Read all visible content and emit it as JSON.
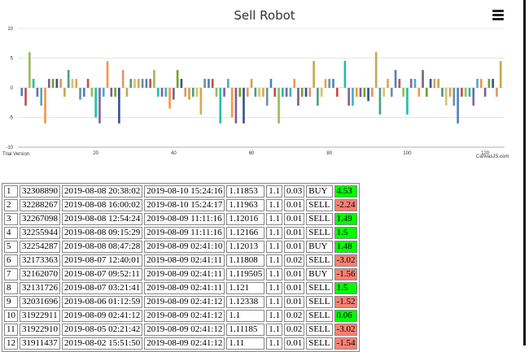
{
  "chart": {
    "menu_icon": "hamburger-icon",
    "trial_text": "Trial Version",
    "credit_text": "CanvasJS.com"
  },
  "chart_data": {
    "type": "bar",
    "title": "Sell Robot",
    "xlabel": "",
    "ylabel": "",
    "ylim": [
      -10,
      10
    ],
    "xlim": [
      0,
      125
    ],
    "yticks": [
      -10,
      -5,
      0,
      5,
      10
    ],
    "xticks": [
      20,
      40,
      60,
      80,
      100,
      120
    ],
    "grid": true,
    "colors": [
      "#4F81BC",
      "#C0504E",
      "#9BBB58",
      "#23BFAA",
      "#8064A1",
      "#4AACC5",
      "#F79647",
      "#7F6084",
      "#77A033",
      "#33558B",
      "#E59566",
      "#C2AA4C",
      "#4D9E80",
      "#D1C56C",
      "#E0A54D",
      "#6B8FAA"
    ],
    "x": [
      1,
      2,
      3,
      4,
      5,
      6,
      7,
      8,
      9,
      10,
      11,
      12,
      13,
      14,
      15,
      16,
      17,
      18,
      19,
      20,
      21,
      22,
      23,
      24,
      25,
      26,
      27,
      28,
      29,
      30,
      31,
      32,
      33,
      34,
      35,
      36,
      37,
      38,
      39,
      40,
      41,
      42,
      43,
      44,
      45,
      46,
      47,
      48,
      49,
      50,
      51,
      52,
      53,
      54,
      55,
      56,
      57,
      58,
      59,
      60,
      61,
      62,
      63,
      64,
      65,
      66,
      67,
      68,
      69,
      70,
      71,
      72,
      73,
      74,
      75,
      76,
      77,
      78,
      79,
      80,
      81,
      82,
      83,
      84,
      85,
      86,
      87,
      88,
      89,
      90,
      91,
      92,
      93,
      94,
      95,
      96,
      97,
      98,
      99,
      100,
      101,
      102,
      103,
      104,
      105,
      106,
      107,
      108,
      109,
      110,
      111,
      112,
      113,
      114,
      115,
      116,
      117,
      118,
      119,
      120,
      121,
      122,
      123,
      124
    ],
    "values": [
      -1.4,
      -3,
      6,
      1.5,
      -1.5,
      -3,
      -6,
      1.5,
      1.5,
      1.5,
      1.5,
      -1.5,
      3,
      1.5,
      1.5,
      -2,
      -1.5,
      1.5,
      -1.5,
      -5,
      -6,
      -1.5,
      4.5,
      -1.5,
      -1.5,
      -6,
      3,
      -1.5,
      1.5,
      1.5,
      1.5,
      1.5,
      1.5,
      1.5,
      3,
      -1.5,
      -1.5,
      -1.5,
      -3.5,
      -2,
      3,
      1.5,
      -1.5,
      -2,
      -1.5,
      -1.5,
      -4.5,
      1.5,
      1.5,
      1.5,
      -1.5,
      -6,
      -1.5,
      1.5,
      -5,
      -6,
      -1.5,
      -6,
      -1.5,
      1.5,
      -1.5,
      -1.5,
      -1.5,
      -3,
      1.5,
      -1.5,
      -6,
      -1.5,
      -1.5,
      -1.5,
      1.5,
      -3,
      -1.5,
      -1.5,
      -1.5,
      4.5,
      -3,
      -1.5,
      1.48,
      1.49,
      1.5,
      -1.5,
      0.06,
      4.53,
      -3.02,
      -3.02,
      -1.52,
      -1.54,
      -1.56,
      -2.24,
      -1.5,
      6,
      -4.5,
      -1.5,
      1.5,
      -1.5,
      3,
      1.5,
      -1.5,
      -4.5,
      1.5,
      1.5,
      -1.5,
      3,
      -1.5,
      1.5,
      1.5,
      1.5,
      -1.5,
      -3,
      -1.5,
      -3,
      -6,
      -1.5,
      -1.5,
      -1.5,
      -3,
      1.5,
      1.5,
      -1.5,
      1.5,
      1.5,
      -1.5,
      4.5
    ]
  },
  "table": {
    "rows": [
      {
        "n": "1",
        "ticket": "32308890",
        "open": "2019-08-08 20:38:02",
        "close": "2019-08-10 15:24:16",
        "price": "1.11853",
        "lev": "1.1",
        "lot": "0.03",
        "side": "BUY",
        "pl": "4.53",
        "pl_sign": "pos"
      },
      {
        "n": "2",
        "ticket": "32288267",
        "open": "2019-08-08 16:00:02",
        "close": "2019-08-10 15:24:17",
        "price": "1.11963",
        "lev": "1.1",
        "lot": "0.01",
        "side": "SELL",
        "pl": "-2.24",
        "pl_sign": "neg"
      },
      {
        "n": "3",
        "ticket": "32267098",
        "open": "2019-08-08 12:54:24",
        "close": "2019-08-09 11:11:16",
        "price": "1.12016",
        "lev": "1.1",
        "lot": "0.01",
        "side": "SELL",
        "pl": "1.49",
        "pl_sign": "pos"
      },
      {
        "n": "4",
        "ticket": "32255944",
        "open": "2019-08-08 09:15:29",
        "close": "2019-08-09 11:11:16",
        "price": "1.12166",
        "lev": "1.1",
        "lot": "0.01",
        "side": "SELL",
        "pl": "1.5",
        "pl_sign": "pos"
      },
      {
        "n": "5",
        "ticket": "32254287",
        "open": "2019-08-08 08:47:28",
        "close": "2019-08-09 02:41:10",
        "price": "1.12013",
        "lev": "1.1",
        "lot": "0.01",
        "side": "BUY",
        "pl": "1.48",
        "pl_sign": "pos"
      },
      {
        "n": "6",
        "ticket": "32173363",
        "open": "2019-08-07 12:40:01",
        "close": "2019-08-09 02:41:11",
        "price": "1.11808",
        "lev": "1.1",
        "lot": "0.02",
        "side": "SELL",
        "pl": "-3.02",
        "pl_sign": "neg"
      },
      {
        "n": "7",
        "ticket": "32162070",
        "open": "2019-08-07 09:52:11",
        "close": "2019-08-09 02:41:11",
        "price": "1.119505",
        "lev": "1.1",
        "lot": "0.01",
        "side": "BUY",
        "pl": "-1.56",
        "pl_sign": "neg"
      },
      {
        "n": "8",
        "ticket": "32131726",
        "open": "2019-08-07 03:21:41",
        "close": "2019-08-09 02:41:11",
        "price": "1.121",
        "lev": "1.1",
        "lot": "0.01",
        "side": "SELL",
        "pl": "1.5",
        "pl_sign": "pos"
      },
      {
        "n": "9",
        "ticket": "32031696",
        "open": "2019-08-06 01:12:59",
        "close": "2019-08-09 02:41:12",
        "price": "1.12338",
        "lev": "1.1",
        "lot": "0.01",
        "side": "SELL",
        "pl": "-1.52",
        "pl_sign": "neg"
      },
      {
        "n": "10",
        "ticket": "31922911",
        "open": "2019-08-09 02:41:12",
        "close": "2019-08-09 02:41:12",
        "price": "1.1",
        "lev": "1.1",
        "lot": "0.02",
        "side": "SELL",
        "pl": "0.06",
        "pl_sign": "pos"
      },
      {
        "n": "11",
        "ticket": "31922910",
        "open": "2019-08-05 02:21:42",
        "close": "2019-08-09 02:41:12",
        "price": "1.11185",
        "lev": "1.1",
        "lot": "0.02",
        "side": "SELL",
        "pl": "-3.02",
        "pl_sign": "neg"
      },
      {
        "n": "12",
        "ticket": "31911437",
        "open": "2019-08-02 15:51:50",
        "close": "2019-08-09 02:41:12",
        "price": "1.11",
        "lev": "1.1",
        "lot": "0.01",
        "side": "SELL",
        "pl": "-1.54",
        "pl_sign": "neg"
      }
    ]
  }
}
